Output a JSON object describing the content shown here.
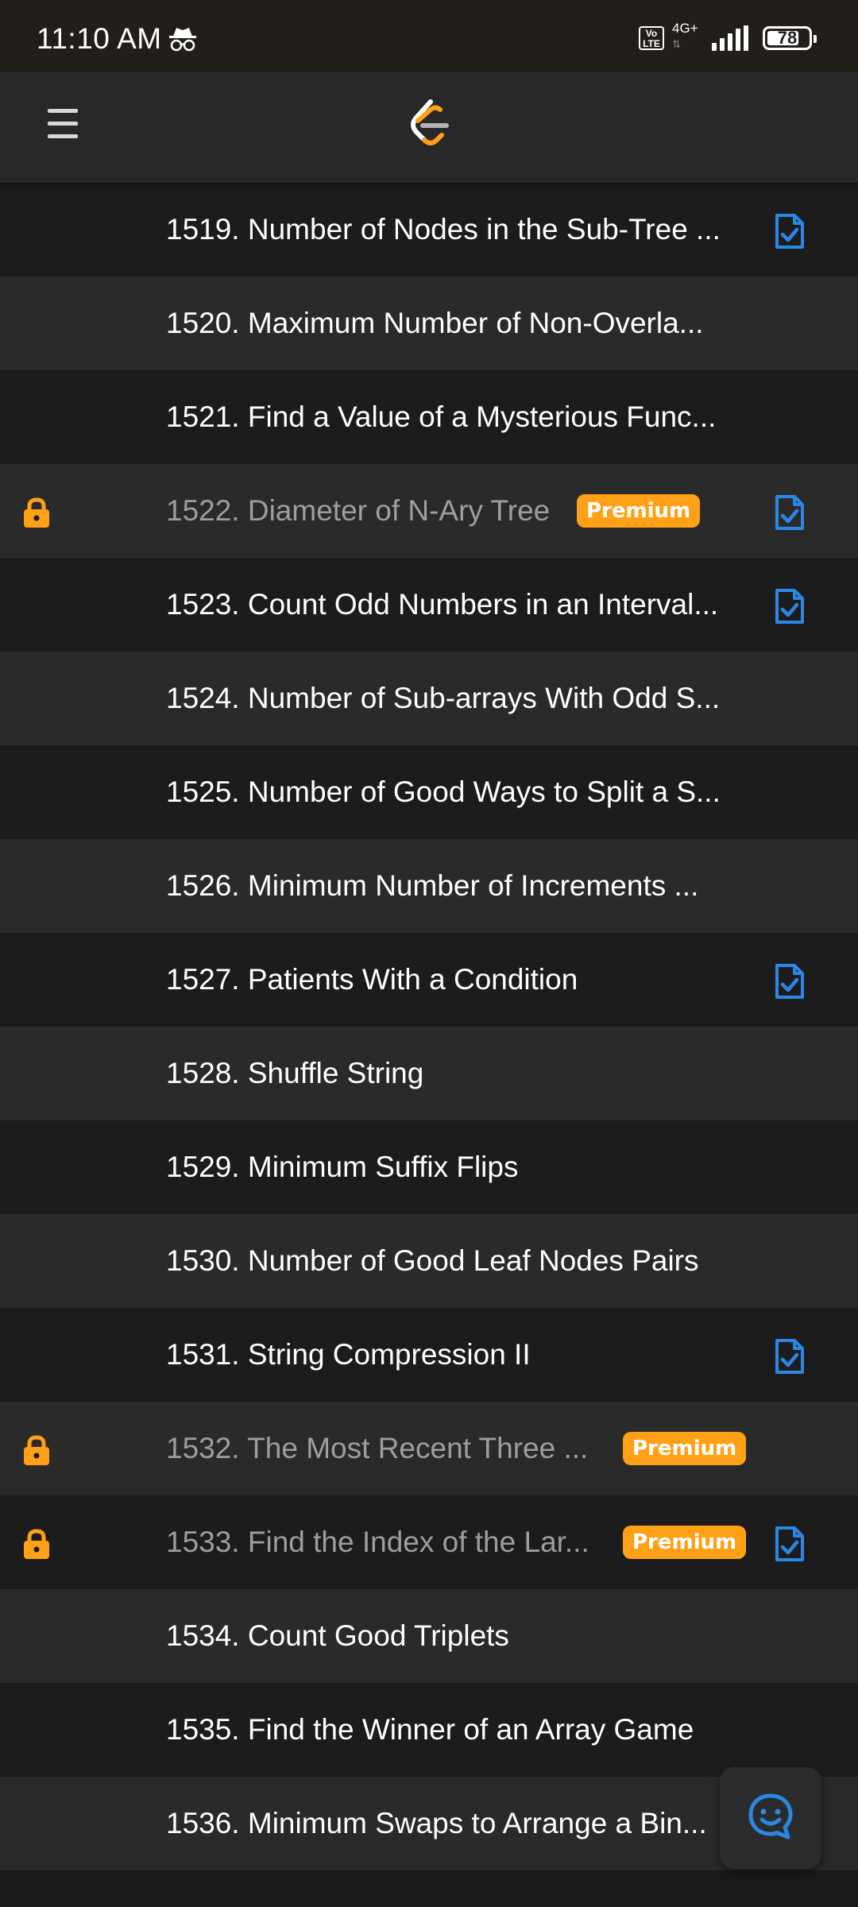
{
  "status_bar": {
    "time": "11:10 AM",
    "volte_line1": "Vo",
    "volte_line2": "LTE",
    "network": "4G+",
    "battery": "78",
    "icons": [
      "incognito-icon",
      "volte-icon",
      "signal-icon",
      "battery-icon"
    ]
  },
  "app_bar": {
    "menu_icon": "hamburger-menu-icon",
    "logo_icon": "leetcode-logo-icon"
  },
  "colors": {
    "premium": "#ffa116",
    "solved_icon": "#2a87e6",
    "lock": "#ffa116",
    "row_dark": "#1c1c1c",
    "row_light": "#2a2a2a",
    "app_bar": "#282828",
    "status_bar": "#221f1b"
  },
  "problems": [
    {
      "title": "1519. Number of Nodes in the Sub-Tree ...",
      "locked": false,
      "premium_label": "",
      "solved": true
    },
    {
      "title": "1520. Maximum Number of Non-Overla...",
      "locked": false,
      "premium_label": "",
      "solved": false
    },
    {
      "title": "1521. Find a Value of a Mysterious Func...",
      "locked": false,
      "premium_label": "",
      "solved": false
    },
    {
      "title": "1522. Diameter of N-Ary Tree",
      "locked": true,
      "premium_label": "Premium",
      "solved": true
    },
    {
      "title": "1523. Count Odd Numbers in an Interval...",
      "locked": false,
      "premium_label": "",
      "solved": true
    },
    {
      "title": "1524. Number of Sub-arrays With Odd S...",
      "locked": false,
      "premium_label": "",
      "solved": false
    },
    {
      "title": "1525. Number of Good Ways to Split a S...",
      "locked": false,
      "premium_label": "",
      "solved": false
    },
    {
      "title": "1526. Minimum Number of Increments ...",
      "locked": false,
      "premium_label": "",
      "solved": false
    },
    {
      "title": "1527. Patients With a Condition",
      "locked": false,
      "premium_label": "",
      "solved": true
    },
    {
      "title": "1528. Shuffle String",
      "locked": false,
      "premium_label": "",
      "solved": false
    },
    {
      "title": "1529. Minimum Suffix Flips",
      "locked": false,
      "premium_label": "",
      "solved": false
    },
    {
      "title": "1530. Number of Good Leaf Nodes Pairs",
      "locked": false,
      "premium_label": "",
      "solved": false
    },
    {
      "title": "1531. String Compression II",
      "locked": false,
      "premium_label": "",
      "solved": true
    },
    {
      "title": "1532. The Most Recent Three ...",
      "locked": true,
      "premium_label": "Premium",
      "solved": false
    },
    {
      "title": "1533. Find the Index of the Lar...",
      "locked": true,
      "premium_label": "Premium",
      "solved": true
    },
    {
      "title": "1534. Count Good Triplets",
      "locked": false,
      "premium_label": "",
      "solved": false
    },
    {
      "title": "1535. Find the Winner of an Array Game",
      "locked": false,
      "premium_label": "",
      "solved": false
    },
    {
      "title": "1536. Minimum Swaps to Arrange a Bin...",
      "locked": false,
      "premium_label": "",
      "solved": false
    }
  ],
  "fab": {
    "icon": "feedback-smiley-icon"
  }
}
